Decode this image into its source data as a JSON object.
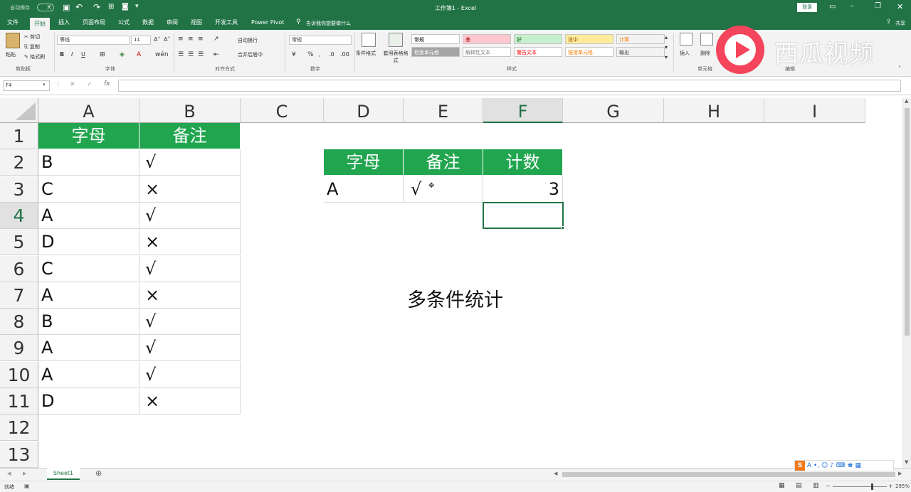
{
  "window": {
    "autosave_label": "自动保存",
    "autosave_state": "关",
    "title": "工作簿1 - Excel",
    "login_button": "登录",
    "share_button": "共享"
  },
  "menu": [
    "文件",
    "开始",
    "插入",
    "页面布局",
    "公式",
    "数据",
    "审阅",
    "视图",
    "开发工具",
    "Power Pivot"
  ],
  "search_placeholder": "告诉我你想要做什么",
  "ribbon": {
    "paste": "粘贴",
    "cut": "剪切",
    "copy": "复制",
    "format_painter": "格式刷",
    "clipboard_group": "剪贴板",
    "font_name": "等线",
    "font_size": "11",
    "font_group": "字体",
    "wrap_text": "自动换行",
    "merge_center": "合并后居中",
    "alignment_group": "对齐方式",
    "number_format": "常规",
    "number_group": "数字",
    "conditional_format": "条件格式",
    "format_as_table": "套用表格格式",
    "styles_group": "样式",
    "insert": "插入",
    "delete": "删除",
    "cells_group": "单元格",
    "editing_group": "编辑",
    "styles": [
      {
        "label": "常规",
        "bg": "#ffffff",
        "fg": "#000000"
      },
      {
        "label": "差",
        "bg": "#ffc7ce",
        "fg": "#9c0006"
      },
      {
        "label": "好",
        "bg": "#c6efce",
        "fg": "#006100"
      },
      {
        "label": "适中",
        "bg": "#ffeb9c",
        "fg": "#9c5700"
      },
      {
        "label": "计算",
        "bg": "#f2f2f2",
        "fg": "#fa7d00"
      },
      {
        "label": "检查单元格",
        "bg": "#a5a5a5",
        "fg": "#ffffff"
      },
      {
        "label": "解释性文本",
        "bg": "#ffffff",
        "fg": "#7f7f7f"
      },
      {
        "label": "警告文本",
        "bg": "#ffffff",
        "fg": "#ff0000"
      },
      {
        "label": "链接单元格",
        "bg": "#ffffff",
        "fg": "#fa7d00"
      },
      {
        "label": "输出",
        "bg": "#f2f2f2",
        "fg": "#3f3f3f"
      }
    ]
  },
  "namebox": "F4",
  "columns": [
    "A",
    "B",
    "C",
    "D",
    "E",
    "F",
    "G",
    "H",
    "I"
  ],
  "rows": [
    "1",
    "2",
    "3",
    "4",
    "5",
    "6",
    "7",
    "8",
    "9",
    "10",
    "11",
    "12",
    "13"
  ],
  "selected_cell": "F4",
  "table1": {
    "headers": [
      "字母",
      "备注"
    ],
    "rows": [
      [
        "B",
        "√"
      ],
      [
        "C",
        "×"
      ],
      [
        "A",
        "√"
      ],
      [
        "D",
        "×"
      ],
      [
        "C",
        "√"
      ],
      [
        "A",
        "×"
      ],
      [
        "B",
        "√"
      ],
      [
        "A",
        "√"
      ],
      [
        "A",
        "√"
      ],
      [
        "D",
        "×"
      ]
    ]
  },
  "table2": {
    "headers": [
      "字母",
      "备注",
      "计数"
    ],
    "row": [
      "A",
      "√",
      "3"
    ]
  },
  "caption": "多条件统计",
  "watermark": "西瓜视频",
  "sheet_tab": "Sheet1",
  "status": {
    "ready": "就绪",
    "zoom": "295%"
  },
  "colors": {
    "excel_green": "#217346",
    "header_green": "#21a54f"
  }
}
